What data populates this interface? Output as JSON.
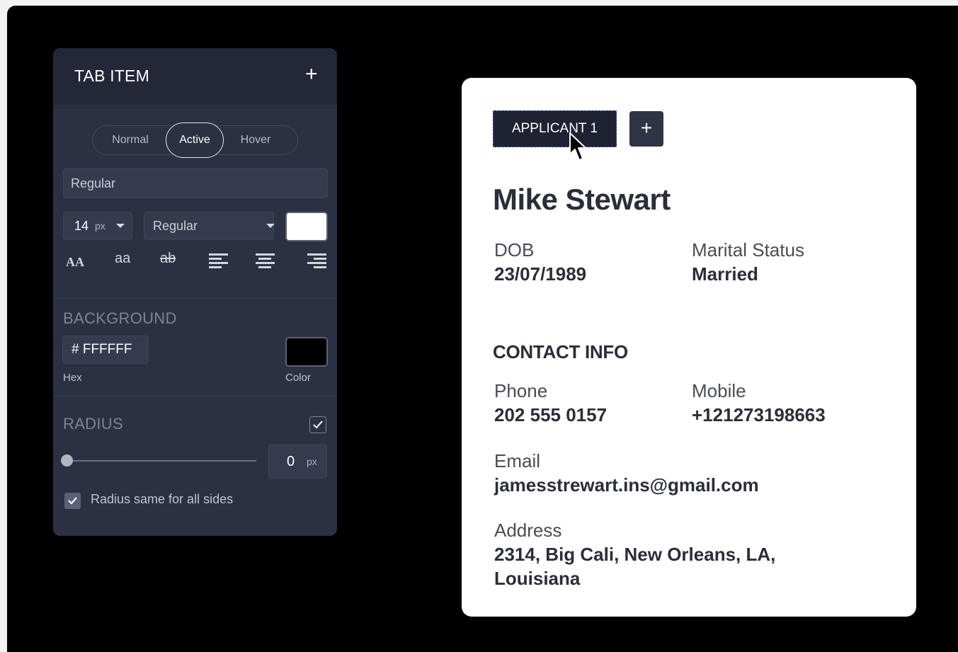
{
  "panel": {
    "title": "TAB ITEM",
    "add_icon": "+",
    "states": {
      "normal": "Normal",
      "active": "Active",
      "hover": "Hover"
    },
    "font_family": "Regular",
    "font_size": "14",
    "font_size_unit": "px",
    "font_weight": "Regular",
    "text_color": "#FFFFFF",
    "format": {
      "uppercase": "AA",
      "lowercase": "aa",
      "strike": "ab"
    },
    "background": {
      "label": "BACKGROUND",
      "hex_value": "# FFFFFF",
      "hex_label": "Hex",
      "color_label": "Color",
      "color": "#000000"
    },
    "radius": {
      "label": "RADIUS",
      "value": "0",
      "unit": "px",
      "enabled": true,
      "same_all_label": "Radius same for all sides",
      "slider_fraction": 0
    }
  },
  "card": {
    "tab_label": "APPLICANT 1",
    "tab_add": "+",
    "name": "Mike Stewart",
    "dob_label": "DOB",
    "dob": "23/07/1989",
    "marital_label": "Marital Status",
    "marital": "Married",
    "contact_heading": "CONTACT INFO",
    "phone_label": "Phone",
    "phone": "202 555 0157",
    "mobile_label": "Mobile",
    "mobile": "+121273198663",
    "email_label": "Email",
    "email": "jamesstrewart.ins@gmail.com",
    "address_label": "Address",
    "address_line1": "2314, Big Cali, New Orleans, LA,",
    "address_line2": "Louisiana"
  }
}
